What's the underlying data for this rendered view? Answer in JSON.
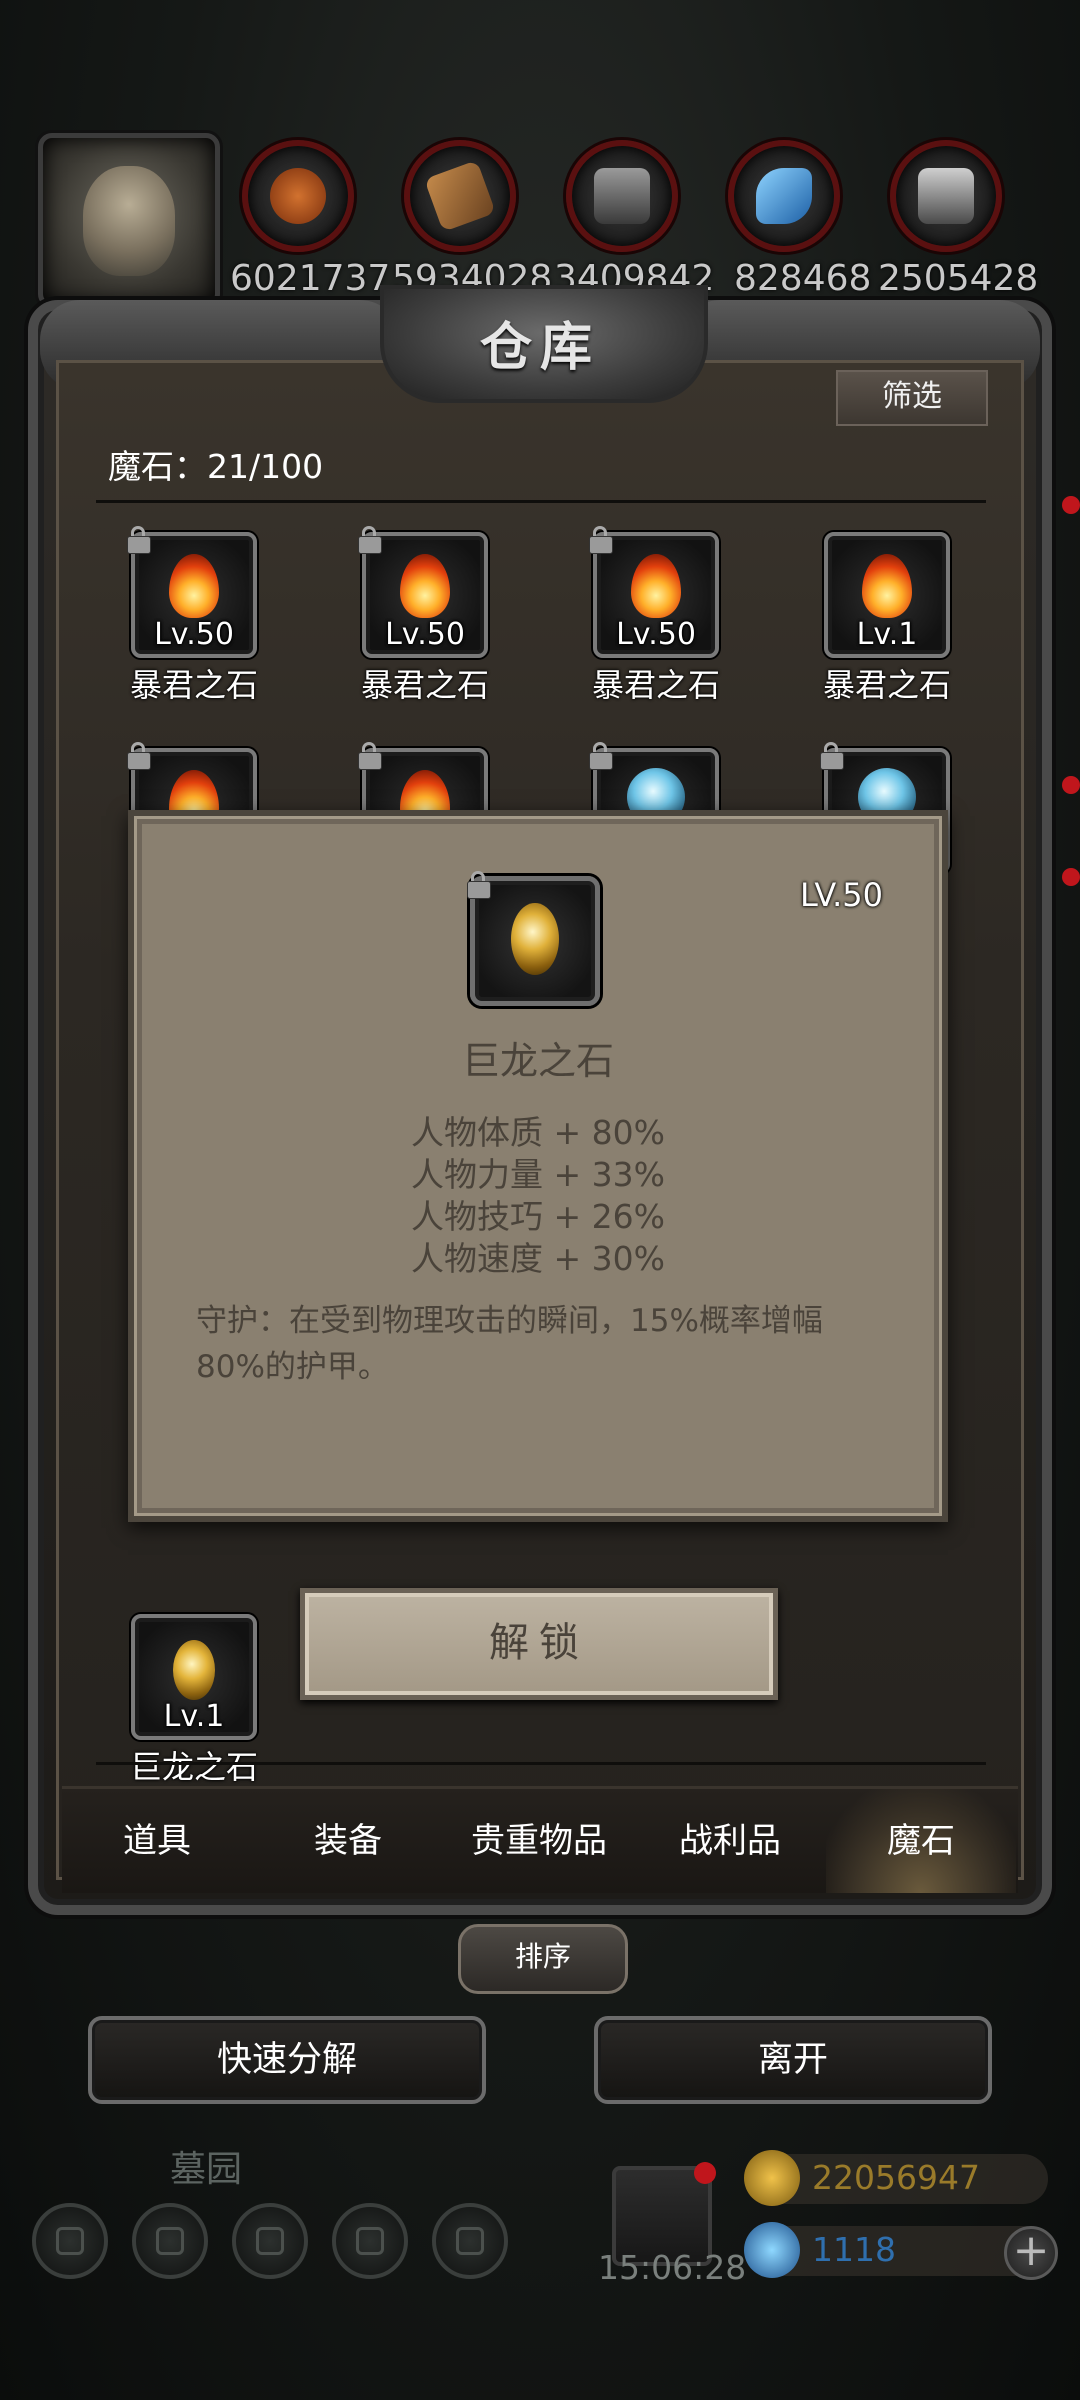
{
  "resources": {
    "values": [
      "6021737",
      "5934028",
      "3409842",
      "828468",
      "2505428"
    ],
    "icons": [
      "fur-icon",
      "wood-icon",
      "iron-icon",
      "crystal-icon",
      "steel-icon"
    ]
  },
  "panel": {
    "title": "仓库",
    "filter_label": "筛选",
    "count_label": "魔石：21/100"
  },
  "grid": {
    "row1": [
      {
        "level": "Lv.50",
        "name": "暴君之石"
      },
      {
        "level": "Lv.50",
        "name": "暴君之石"
      },
      {
        "level": "Lv.50",
        "name": "暴君之石"
      },
      {
        "level": "Lv.1",
        "name": "暴君之石"
      }
    ],
    "last": {
      "level": "Lv.1",
      "name": "巨龙之石"
    }
  },
  "tooltip": {
    "level": "LV.50",
    "name": "巨龙之石",
    "stats": [
      "人物体质 + 80%",
      "人物力量 + 33%",
      "人物技巧 + 26%",
      "人物速度 + 30%"
    ],
    "description": "守护：在受到物理攻击的瞬间，15%概率增幅80%的护甲。",
    "unlock_label": "解锁"
  },
  "tabs": [
    {
      "label": "道具",
      "active": false
    },
    {
      "label": "装备",
      "active": false
    },
    {
      "label": "贵重物品",
      "active": false
    },
    {
      "label": "战利品",
      "active": false
    },
    {
      "label": "魔石",
      "active": true
    }
  ],
  "sort_label": "排序",
  "actions": {
    "decompose_label": "快速分解",
    "leave_label": "离开"
  },
  "hud": {
    "location": "墓园",
    "time": "15:06:28",
    "gold": "22056947",
    "diamond": "1118"
  },
  "colors": {
    "gold_text": "#9a7b2a",
    "diamond_text": "#2f6fae",
    "notify_red": "#c0161c"
  }
}
